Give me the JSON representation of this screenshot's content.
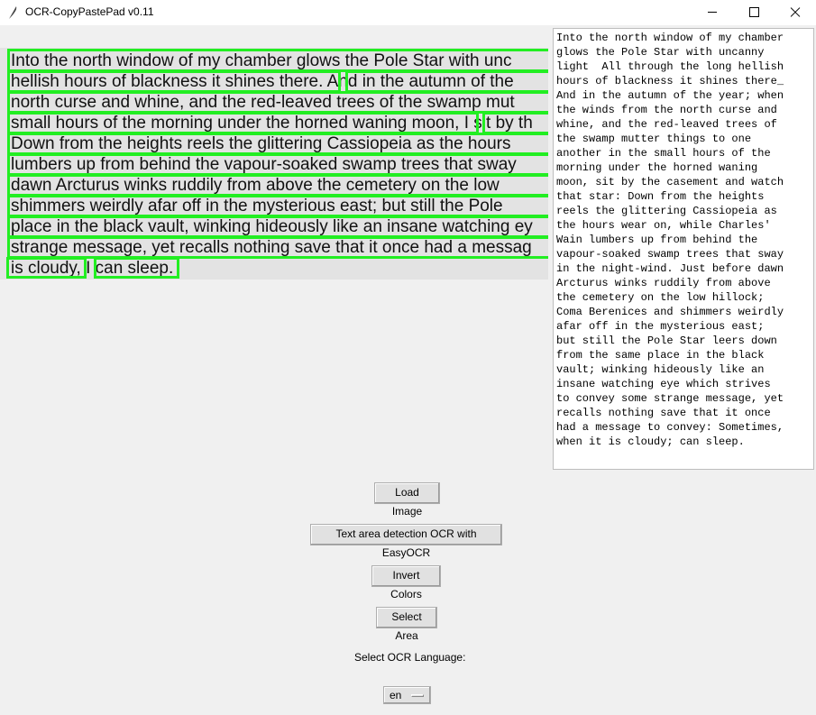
{
  "window": {
    "title": "OCR-CopyPastePad v0.11"
  },
  "image_lines": [
    "Into the north window of my chamber glows the Pole Star with unc",
    "hellish hours of blackness it shines there. And in the autumn of the",
    "north curse and whine, and the red-leaved trees of the swamp mut",
    "small hours of the morning under the horned waning moon, I sit by th",
    "Down from the heights reels the glittering Cassiopeia as the hours",
    "lumbers up from behind the vapour-soaked swamp trees that sway",
    "dawn Arcturus winks ruddily from above the cemetery on the low",
    "shimmers weirdly afar off in the mysterious east; but still the Pole",
    "place in the black vault, winking hideously like an insane watching ey",
    "strange message, yet recalls nothing save that it once had a messag",
    "is cloudy, I can sleep."
  ],
  "ocr_text_lines": [
    "Into the north window of my chamber",
    "glows the Pole Star with uncanny",
    "light  All through the long hellish",
    "hours of blackness it shines there_",
    "And in the autumn of the year; when",
    "the winds from the north curse and",
    "whine, and the red-leaved trees of",
    "the swamp mutter things to one",
    "another in the small hours of the",
    "morning under the horned waning",
    "moon, sit by the casement and watch",
    "that star: Down from the heights",
    "reels the glittering Cassiopeia as",
    "the hours wear on, while Charles'",
    "Wain lumbers up from behind the",
    "vapour-soaked swamp trees that sway",
    "in the night-wind. Just before dawn",
    "Arcturus winks ruddily from above",
    "the cemetery on the low hillock;",
    "Coma Berenices and shimmers weirdly",
    "afar off in the mysterious east;",
    "but still the Pole Star leers down",
    "from the same place in the black",
    "vault; winking hideously like an",
    "insane watching eye which strives",
    "to convey some strange message, yet",
    "recalls nothing save that it once",
    "had a message to convey: Sometimes,",
    "when it is cloudy; can sleep."
  ],
  "buttons": {
    "load_image": "Load Image",
    "detect_ocr": "Text area detection OCR with EasyOCR",
    "invert": "Invert Colors",
    "select_area": "Select Area"
  },
  "language": {
    "label": "Select OCR Language:",
    "value": "en"
  },
  "colors": {
    "box": "#22ee22",
    "canvas_bg": "#e3e3e3"
  },
  "icons": [
    "feather-icon",
    "minimize-icon",
    "maximize-icon",
    "close-icon",
    "chevron-down-icon"
  ]
}
